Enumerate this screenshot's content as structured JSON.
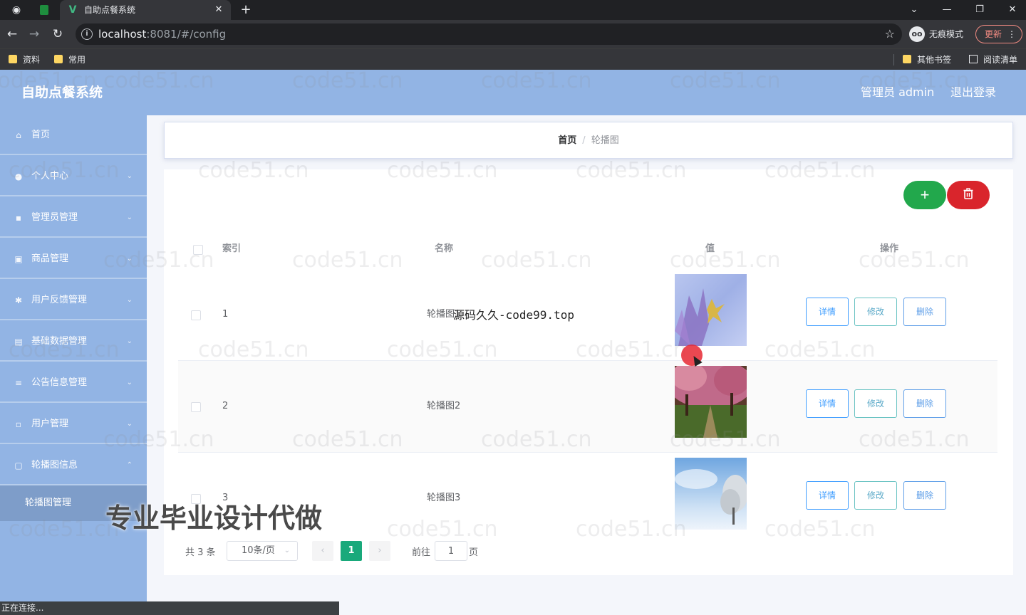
{
  "browser": {
    "tab_title": "自助点餐系统",
    "url_host": "localhost",
    "url_path": ":8081/#/config",
    "incognito_label": "无痕模式",
    "update_label": "更新",
    "bookmarks": [
      "资料",
      "常用"
    ],
    "bookmarks_right": [
      "其他书签",
      "阅读清单"
    ]
  },
  "header": {
    "title": "自助点餐系统",
    "admin_label": "管理员 admin",
    "logout_label": "退出登录"
  },
  "sidebar": {
    "items": [
      {
        "label": "首页",
        "icon": "home-icon"
      },
      {
        "label": "个人中心",
        "icon": "user-icon"
      },
      {
        "label": "管理员管理",
        "icon": "admin-icon"
      },
      {
        "label": "商品管理",
        "icon": "goods-icon"
      },
      {
        "label": "用户反馈管理",
        "icon": "feedback-icon"
      },
      {
        "label": "基础数据管理",
        "icon": "data-icon"
      },
      {
        "label": "公告信息管理",
        "icon": "list-icon"
      },
      {
        "label": "用户管理",
        "icon": "users-icon"
      },
      {
        "label": "轮播图信息",
        "icon": "carousel-icon"
      }
    ],
    "active_sub": "轮播图管理"
  },
  "breadcrumb": {
    "home": "首页",
    "separator": "/",
    "current": "轮播图"
  },
  "table": {
    "columns": {
      "index": "索引",
      "name": "名称",
      "value": "值",
      "actions": "操作"
    },
    "rows": [
      {
        "index": "1",
        "name": "轮播图1"
      },
      {
        "index": "2",
        "name": "轮播图2"
      },
      {
        "index": "3",
        "name": "轮播图3"
      }
    ],
    "actions": {
      "detail": "详情",
      "edit": "修改",
      "delete": "删除"
    }
  },
  "pagination": {
    "total": "共 3 条",
    "page_size": "10条/页",
    "current_page": "1",
    "goto_label": "前往",
    "goto_value": "1",
    "page_unit": "页"
  },
  "overlays": {
    "watermark": "code51.cn",
    "source_text": "源码久久-code99.top",
    "promo_text": "专业毕业设计代做"
  },
  "status_text": "正在连接..."
}
